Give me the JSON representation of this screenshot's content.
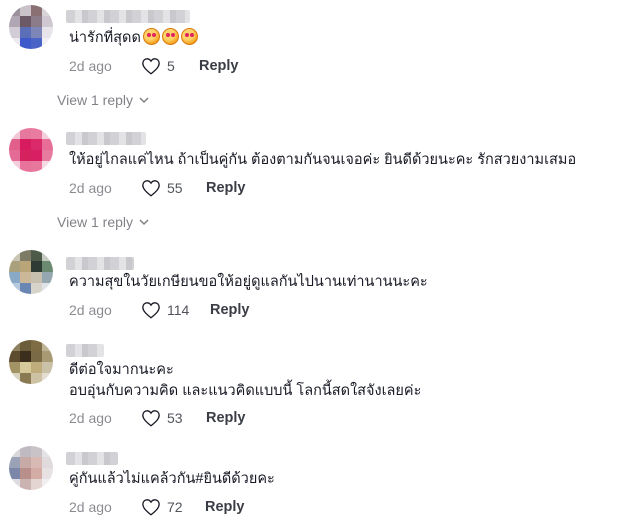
{
  "comments": [
    {
      "text": "น่ารักที่สุดด",
      "emoji": [
        "smiling-face-with-heart-eyes",
        "smiling-face-with-heart-eyes",
        "smiling-face-with-heart-eyes"
      ],
      "date": "2d ago",
      "likes": "5",
      "reply_label": "Reply",
      "view_replies": "View 1 reply"
    },
    {
      "text": "ให้อยู่ไกลแค่ไหน ถ้าเป็นคู่กัน ต้องตามกันจนเจอค่ะ ยินดีด้วยนะคะ รักสวยงามเสมอ",
      "date": "2d ago",
      "likes": "55",
      "reply_label": "Reply",
      "view_replies": "View 1 reply"
    },
    {
      "text": "ความสุขในวัยเกษียนขอให้อยู่ดูแลกันไปนานเท่านานนะคะ",
      "date": "2d ago",
      "likes": "114",
      "reply_label": "Reply"
    },
    {
      "text_line1": "ดีต่อใจมากนะคะ",
      "text_line2": "อบอุ่นกับความคิด และแนวคิดแบบนี้ โลกนี้สดใสจังเลยค่ะ",
      "date": "2d ago",
      "likes": "53",
      "reply_label": "Reply"
    },
    {
      "text": "คู่กันแล้วไม่แคล้วกัน#ยินดีด้วยคะ",
      "date": "2d ago",
      "likes": "72",
      "reply_label": "Reply"
    }
  ],
  "icons": {
    "like": "heart-outline-icon",
    "expand": "chevron-down-icon"
  },
  "colors": {
    "text": "#161823",
    "secondary": "#8a8b91",
    "reply": "#3b3d46"
  }
}
